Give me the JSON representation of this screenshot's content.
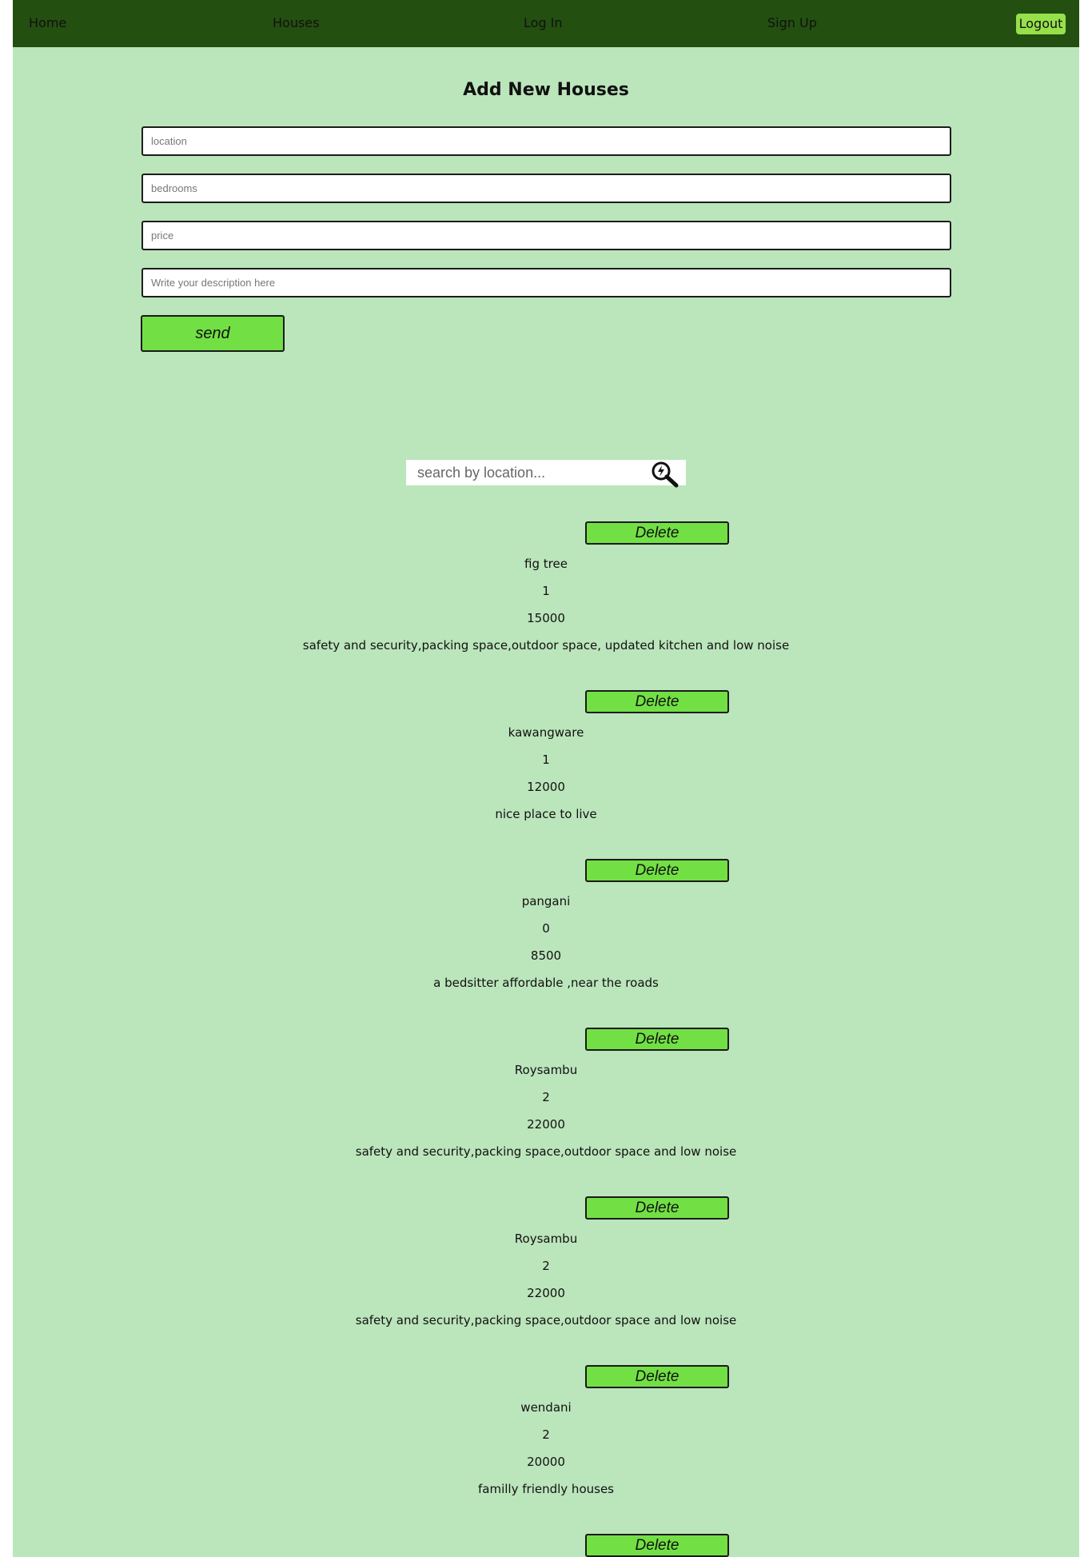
{
  "nav": {
    "home": "Home",
    "houses": "Houses",
    "login": "Log In",
    "signup": "Sign Up",
    "logout": "Logout"
  },
  "form": {
    "title": "Add New Houses",
    "location_placeholder": "location",
    "bedrooms_placeholder": "bedrooms",
    "price_placeholder": "price",
    "description_placeholder": "Write your description here",
    "send_label": "send"
  },
  "search": {
    "placeholder": "search by location...",
    "icon": "search-icon"
  },
  "listings": [
    {
      "delete_label": "Delete",
      "location": "fig tree",
      "bedrooms": "1",
      "price": "15000",
      "description": "safety and security,packing space,outdoor space, updated kitchen and low noise"
    },
    {
      "delete_label": "Delete",
      "location": "kawangware",
      "bedrooms": "1",
      "price": "12000",
      "description": "nice place to live"
    },
    {
      "delete_label": "Delete",
      "location": "pangani",
      "bedrooms": "0",
      "price": "8500",
      "description": "a bedsitter affordable ,near the roads"
    },
    {
      "delete_label": "Delete",
      "location": "Roysambu",
      "bedrooms": "2",
      "price": "22000",
      "description": "safety and security,packing space,outdoor space and low noise"
    },
    {
      "delete_label": "Delete",
      "location": "Roysambu",
      "bedrooms": "2",
      "price": "22000",
      "description": "safety and security,packing space,outdoor space and low noise"
    },
    {
      "delete_label": "Delete",
      "location": "wendani",
      "bedrooms": "2",
      "price": "20000",
      "description": "familly friendly houses"
    },
    {
      "delete_label": "Delete"
    }
  ],
  "colors": {
    "navbar": "#234f10",
    "page_background": "#bbe5bb",
    "button": "#72e044",
    "logout_button": "#96e04a"
  }
}
